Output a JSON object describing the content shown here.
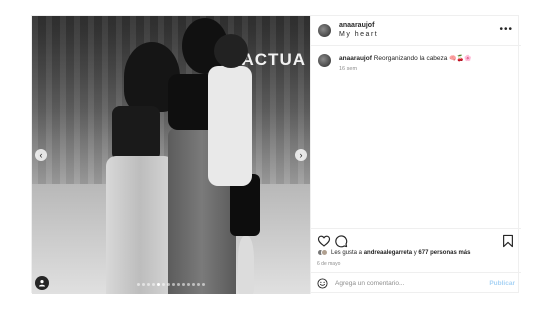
{
  "photo": {
    "sign_text": "ACTUA",
    "carousel": {
      "count": 14,
      "active_index": 4
    },
    "prev_icon": "chevron-left-icon",
    "next_icon": "chevron-right-icon",
    "tag_icon": "user-tag-icon"
  },
  "header": {
    "username": "anaaraujof",
    "subtitle": "My heart",
    "more_icon": "more-horizontal-icon"
  },
  "caption": {
    "username": "anaaraujof",
    "text": "Reorganizando la cabeza",
    "emojis": "🧠🍒🌸",
    "time": "16 sem"
  },
  "actions": {
    "like_icon": "heart-icon",
    "comment_icon": "comment-icon",
    "save_icon": "bookmark-icon"
  },
  "likes": {
    "prefix": "Les gusta a ",
    "user": "andreaalegarreta",
    "middle": " y ",
    "others": "677 personas más"
  },
  "post_date": "6 de mayo",
  "comment": {
    "placeholder": "Agrega un comentario...",
    "publish_label": "Publicar",
    "emoji_icon": "smiley-icon"
  },
  "colors": {
    "publish_disabled": "#a8d3f5",
    "text_primary": "#262626",
    "text_secondary": "#8e8e8e",
    "border": "#efefef"
  }
}
